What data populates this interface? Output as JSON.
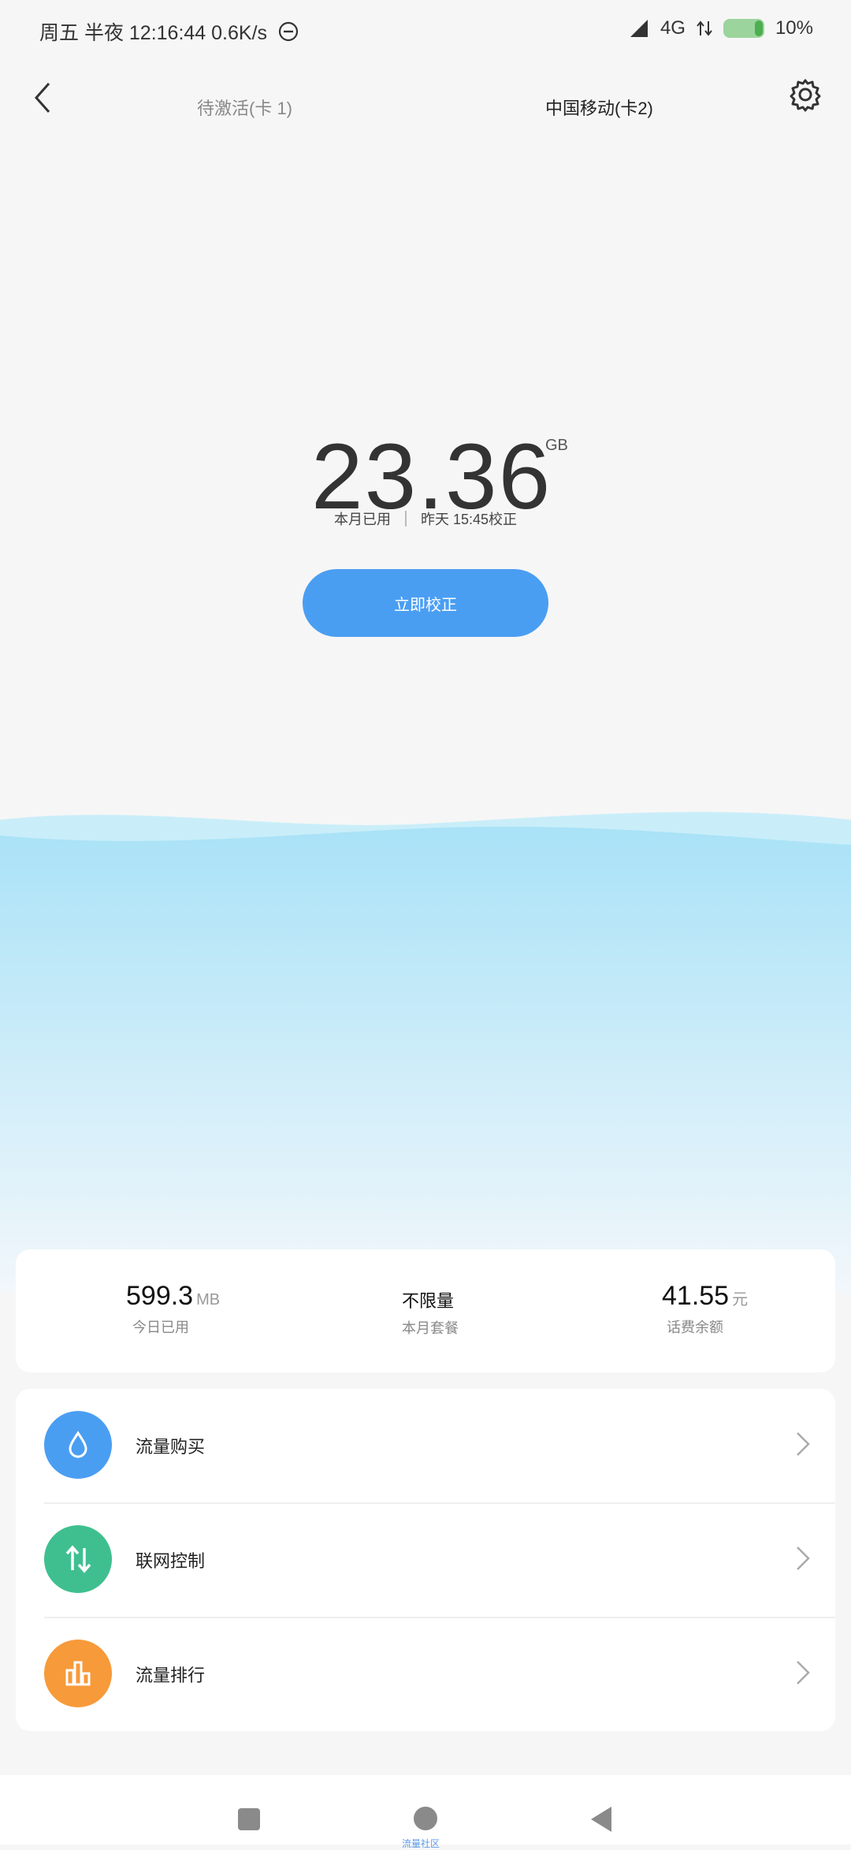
{
  "status_bar": {
    "left_text": "周五 半夜 12:16:44  0.6K/s",
    "signal_label": "4G",
    "battery_percent": "10%"
  },
  "topbar": {
    "tab1": "待激活(卡 1)",
    "tab2": "中国移动(卡2)"
  },
  "usage": {
    "value": "23.36",
    "unit": "GB",
    "label": "本月已用",
    "calibrated_note": "昨天 15:45校正",
    "calibrate_button": "立即校正"
  },
  "summary": [
    {
      "value": "599.3",
      "unit": "MB",
      "label": "今日已用"
    },
    {
      "value": "不限量",
      "unit": "",
      "label": "本月套餐"
    },
    {
      "value": "41.55",
      "unit": "元",
      "label": "话费余额"
    }
  ],
  "menu": [
    {
      "label": "流量购买",
      "icon": "water-drop-icon",
      "color": "#4a9ef2"
    },
    {
      "label": "联网控制",
      "icon": "up-down-arrows-icon",
      "color": "#3fbf8f"
    },
    {
      "label": "流量排行",
      "icon": "bar-chart-icon",
      "color": "#f79a3a"
    }
  ],
  "navbar": {
    "caption": "流量社区"
  },
  "colors": {
    "accent": "#4a9ef2",
    "water_top": "#a9e2f7",
    "water_bottom": "#f2f7fb"
  }
}
